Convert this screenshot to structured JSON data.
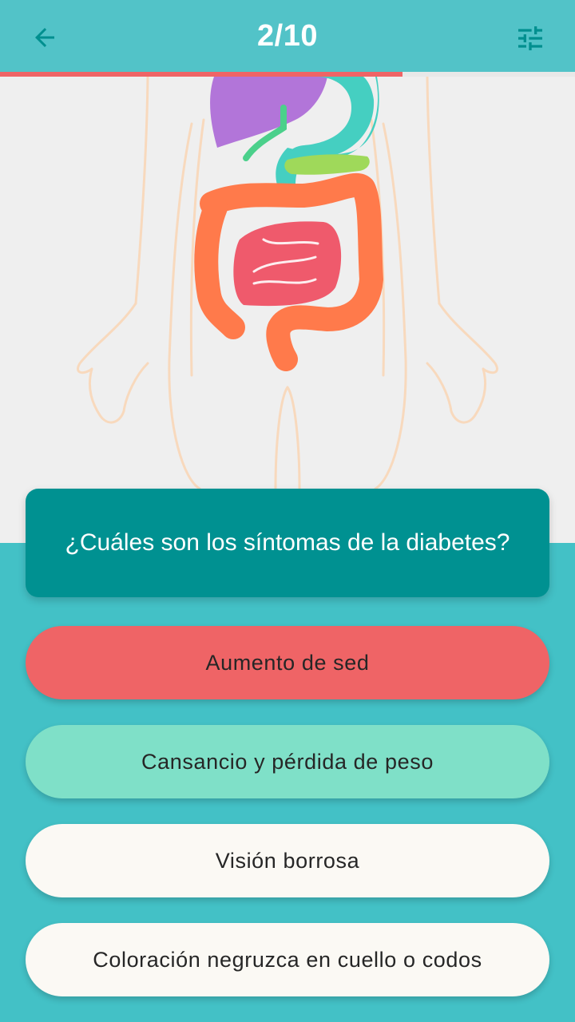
{
  "header": {
    "title": "2/10",
    "back_icon": "arrow-back-icon",
    "filter_icon": "tune-sliders-icon"
  },
  "progress": {
    "value": 0.7,
    "color": "#ef6466"
  },
  "illustration": {
    "subject": "human-digestive-system"
  },
  "question": {
    "text": "¿Cuáles son los síntomas de la diabetes?"
  },
  "answers": [
    {
      "label": "Aumento de sed",
      "color": "#ef6466"
    },
    {
      "label": "Cansancio y pérdida de peso",
      "color": "#7fe0c8"
    },
    {
      "label": "Visión borrosa",
      "color": "#fbf9f4"
    },
    {
      "label": "Coloración negruzca en cuello o codos",
      "color": "#fbf9f4"
    }
  ],
  "colors": {
    "appbar": "#52c3c8",
    "question_bg": "#009191",
    "bottom_bg": "#43c1c6",
    "icon": "#008f8f"
  }
}
